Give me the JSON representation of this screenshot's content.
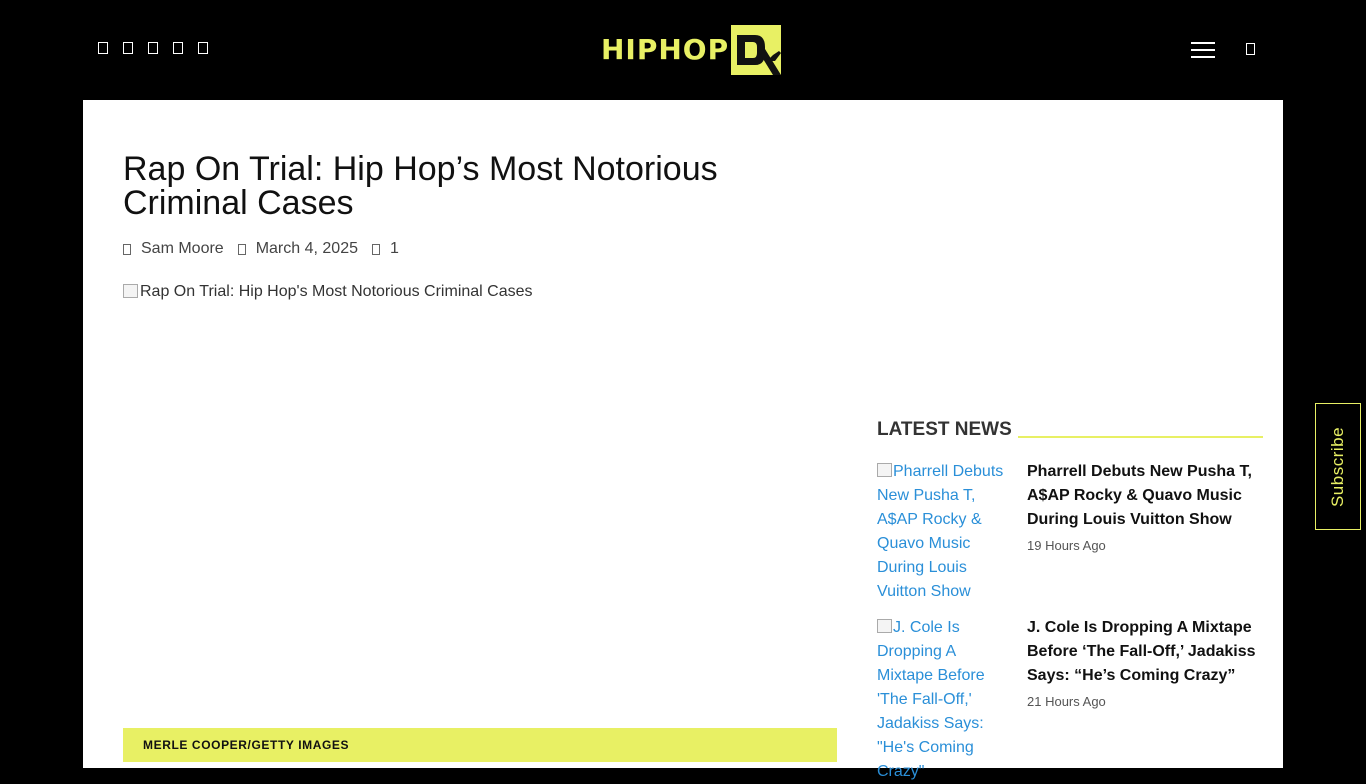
{
  "header": {
    "logo_text": "HIPHOP",
    "social_icons": [
      "facebook-icon",
      "twitter-icon",
      "instagram-icon",
      "youtube-icon",
      "tiktok-icon"
    ],
    "accent_color": "#e8f064"
  },
  "article": {
    "title": "Rap On Trial: Hip Hop’s Most Notorious Criminal Cases",
    "author": "Sam Moore",
    "date": "March 4, 2025",
    "comments": "1",
    "image_alt": "Rap On Trial: Hip Hop's Most Notorious Criminal Cases",
    "image_credit": "MERLE COOPER/GETTY IMAGES"
  },
  "sidebar": {
    "latest_heading": "LATEST NEWS",
    "items": [
      {
        "image_alt": "Pharrell Debuts New Pusha T, A$AP Rocky & Quavo Music During Louis Vuitton Show",
        "title": "Pharrell Debuts New Pusha T, A$AP Rocky & Quavo Music During Louis Vuitton Show",
        "time": "19 Hours Ago"
      },
      {
        "image_alt": "J. Cole Is Dropping A Mixtape Before 'The Fall-Off,' Jadakiss Says: \"He's Coming Crazy\"",
        "title": "J. Cole Is Dropping A Mixtape Before ‘The Fall-Off,’ Jadakiss Says: “He’s Coming Crazy”",
        "time": "21 Hours Ago"
      }
    ]
  },
  "subscribe_label": "Subscribe"
}
